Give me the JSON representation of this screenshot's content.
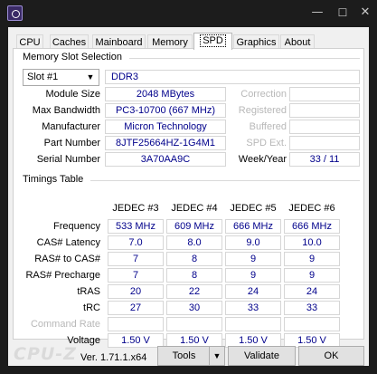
{
  "window": {
    "icon": "cpuz-app-icon",
    "minimize_icon": "minimize-icon",
    "maximize_icon": "maximize-icon",
    "close_icon": "close-icon"
  },
  "tabs": [
    "CPU",
    "Caches",
    "Mainboard",
    "Memory",
    "SPD",
    "Graphics",
    "About"
  ],
  "active_tab": "SPD",
  "memory_slot": {
    "title": "Memory Slot Selection",
    "slot": "Slot #1",
    "type": "DDR3",
    "module_size_label": "Module Size",
    "module_size": "2048 MBytes",
    "max_bandwidth_label": "Max Bandwidth",
    "max_bandwidth": "PC3-10700 (667 MHz)",
    "manufacturer_label": "Manufacturer",
    "manufacturer": "Micron Technology",
    "part_number_label": "Part Number",
    "part_number": "8JTF25664HZ-1G4M1",
    "serial_number_label": "Serial Number",
    "serial_number": "3A70AA9C",
    "correction_label": "Correction",
    "registered_label": "Registered",
    "buffered_label": "Buffered",
    "spd_ext_label": "SPD Ext.",
    "week_year_label": "Week/Year",
    "week_year": "33 / 11"
  },
  "timings": {
    "title": "Timings Table",
    "columns": [
      "JEDEC #3",
      "JEDEC #4",
      "JEDEC #5",
      "JEDEC #6"
    ],
    "rows": [
      {
        "label": "Frequency",
        "values": [
          "533 MHz",
          "609 MHz",
          "666 MHz",
          "666 MHz"
        ]
      },
      {
        "label": "CAS# Latency",
        "values": [
          "7.0",
          "8.0",
          "9.0",
          "10.0"
        ]
      },
      {
        "label": "RAS# to CAS#",
        "values": [
          "7",
          "8",
          "9",
          "9"
        ]
      },
      {
        "label": "RAS# Precharge",
        "values": [
          "7",
          "8",
          "9",
          "9"
        ]
      },
      {
        "label": "tRAS",
        "values": [
          "20",
          "22",
          "24",
          "24"
        ]
      },
      {
        "label": "tRC",
        "values": [
          "27",
          "30",
          "33",
          "33"
        ]
      },
      {
        "label": "Command Rate",
        "values": [
          "",
          "",
          "",
          ""
        ],
        "disabled": true
      },
      {
        "label": "Voltage",
        "values": [
          "1.50 V",
          "1.50 V",
          "1.50 V",
          "1.50 V"
        ]
      }
    ]
  },
  "footer": {
    "brand": "CPU-Z",
    "version": "Ver. 1.71.1.x64",
    "tools_label": "Tools",
    "validate_label": "Validate",
    "ok_label": "OK"
  },
  "colors": {
    "value_text": "#00008b",
    "disabled_text": "#b8b8b8",
    "titlebar": "#1c1c1c",
    "panel": "#f0f0f0"
  }
}
